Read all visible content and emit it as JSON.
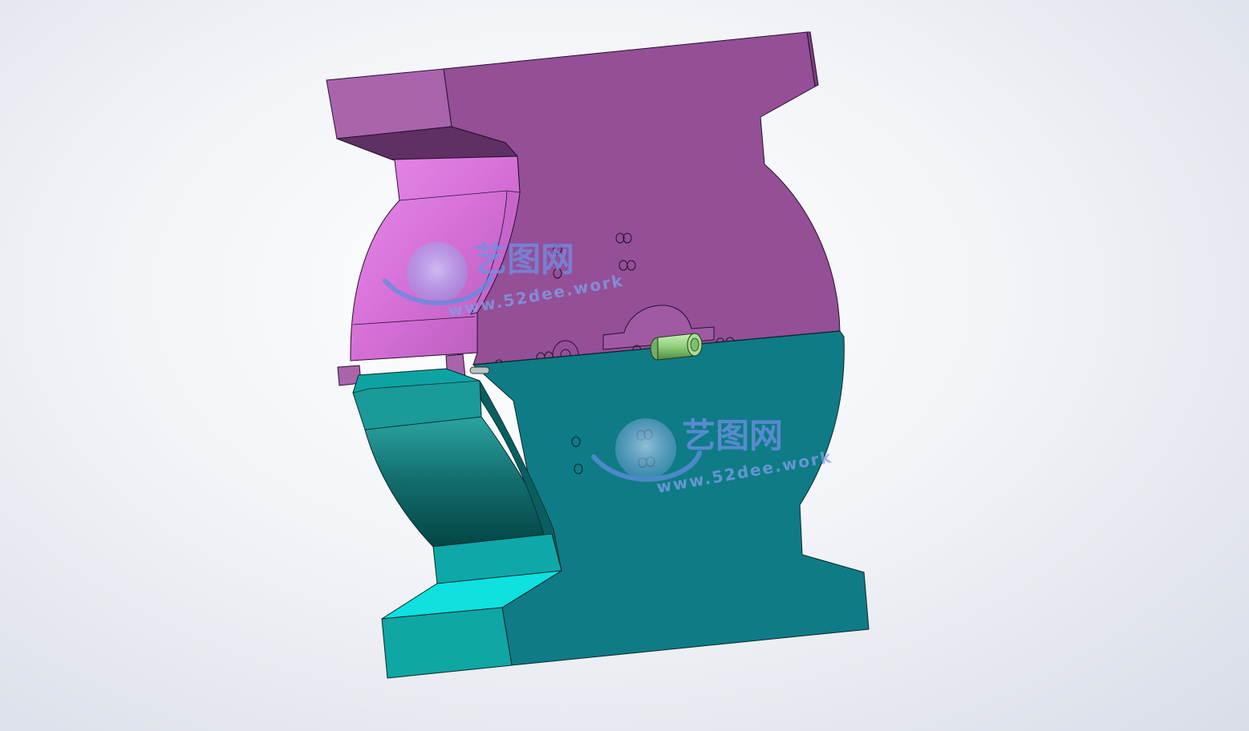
{
  "viewport": {
    "model": "mold assembly",
    "background": "gradient-light-gray"
  },
  "parts": {
    "upper_plate": {
      "name": "upper-mold-plate",
      "color": "#944f97",
      "side_color": "#a960ac",
      "inner_color": "#e07de3"
    },
    "lower_plate": {
      "name": "lower-mold-plate",
      "color": "#0f7b86",
      "side_color": "#0ea3a3",
      "inner_color": "#074a4a"
    },
    "guide_pin": {
      "name": "guide-pin",
      "color": "#8fcf7a"
    }
  },
  "watermarks": [
    {
      "logo_cn": "艺图网",
      "url_text": "www.52dee.work"
    },
    {
      "logo_cn": "艺图网",
      "url_text": "www.52dee.work"
    }
  ]
}
